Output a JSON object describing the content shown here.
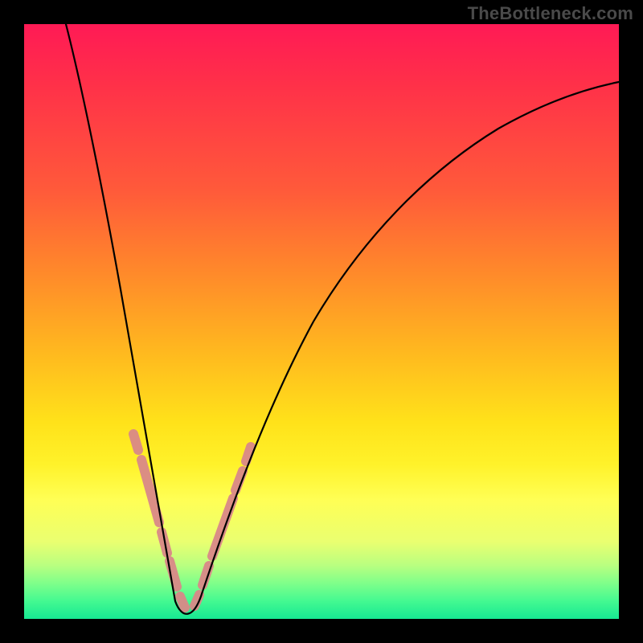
{
  "watermark": "TheBottleneck.com",
  "colors": {
    "frame": "#000000",
    "watermark_text": "#4a4a4a",
    "curve": "#000000",
    "highlight": "#d98888",
    "gradient_top": "#ff1a55",
    "gradient_mid": "#ffe21a",
    "gradient_bottom": "#17e892"
  },
  "chart_data": {
    "type": "line",
    "title": "",
    "xlabel": "",
    "ylabel": "",
    "xlim": [
      0,
      100
    ],
    "ylim": [
      0,
      100
    ],
    "grid": false,
    "series": [
      {
        "name": "bottleneck-curve",
        "x": [
          0,
          2,
          4,
          6,
          8,
          10,
          12,
          14,
          16,
          18,
          20,
          22,
          24,
          25,
          26,
          28,
          30,
          32,
          34,
          38,
          42,
          46,
          50,
          55,
          60,
          65,
          70,
          75,
          80,
          85,
          90,
          95,
          100
        ],
        "values": [
          100,
          97,
          93,
          89,
          84,
          78,
          72,
          65,
          57,
          48,
          37,
          24,
          10,
          1,
          1,
          10,
          21,
          31,
          39,
          51,
          60,
          67,
          72,
          77,
          80,
          83,
          85,
          87,
          88,
          89,
          90,
          90.5,
          91
        ]
      }
    ],
    "highlighted_region_x": [
      18,
      34
    ],
    "notch_x": 25,
    "notch_value": 0
  }
}
